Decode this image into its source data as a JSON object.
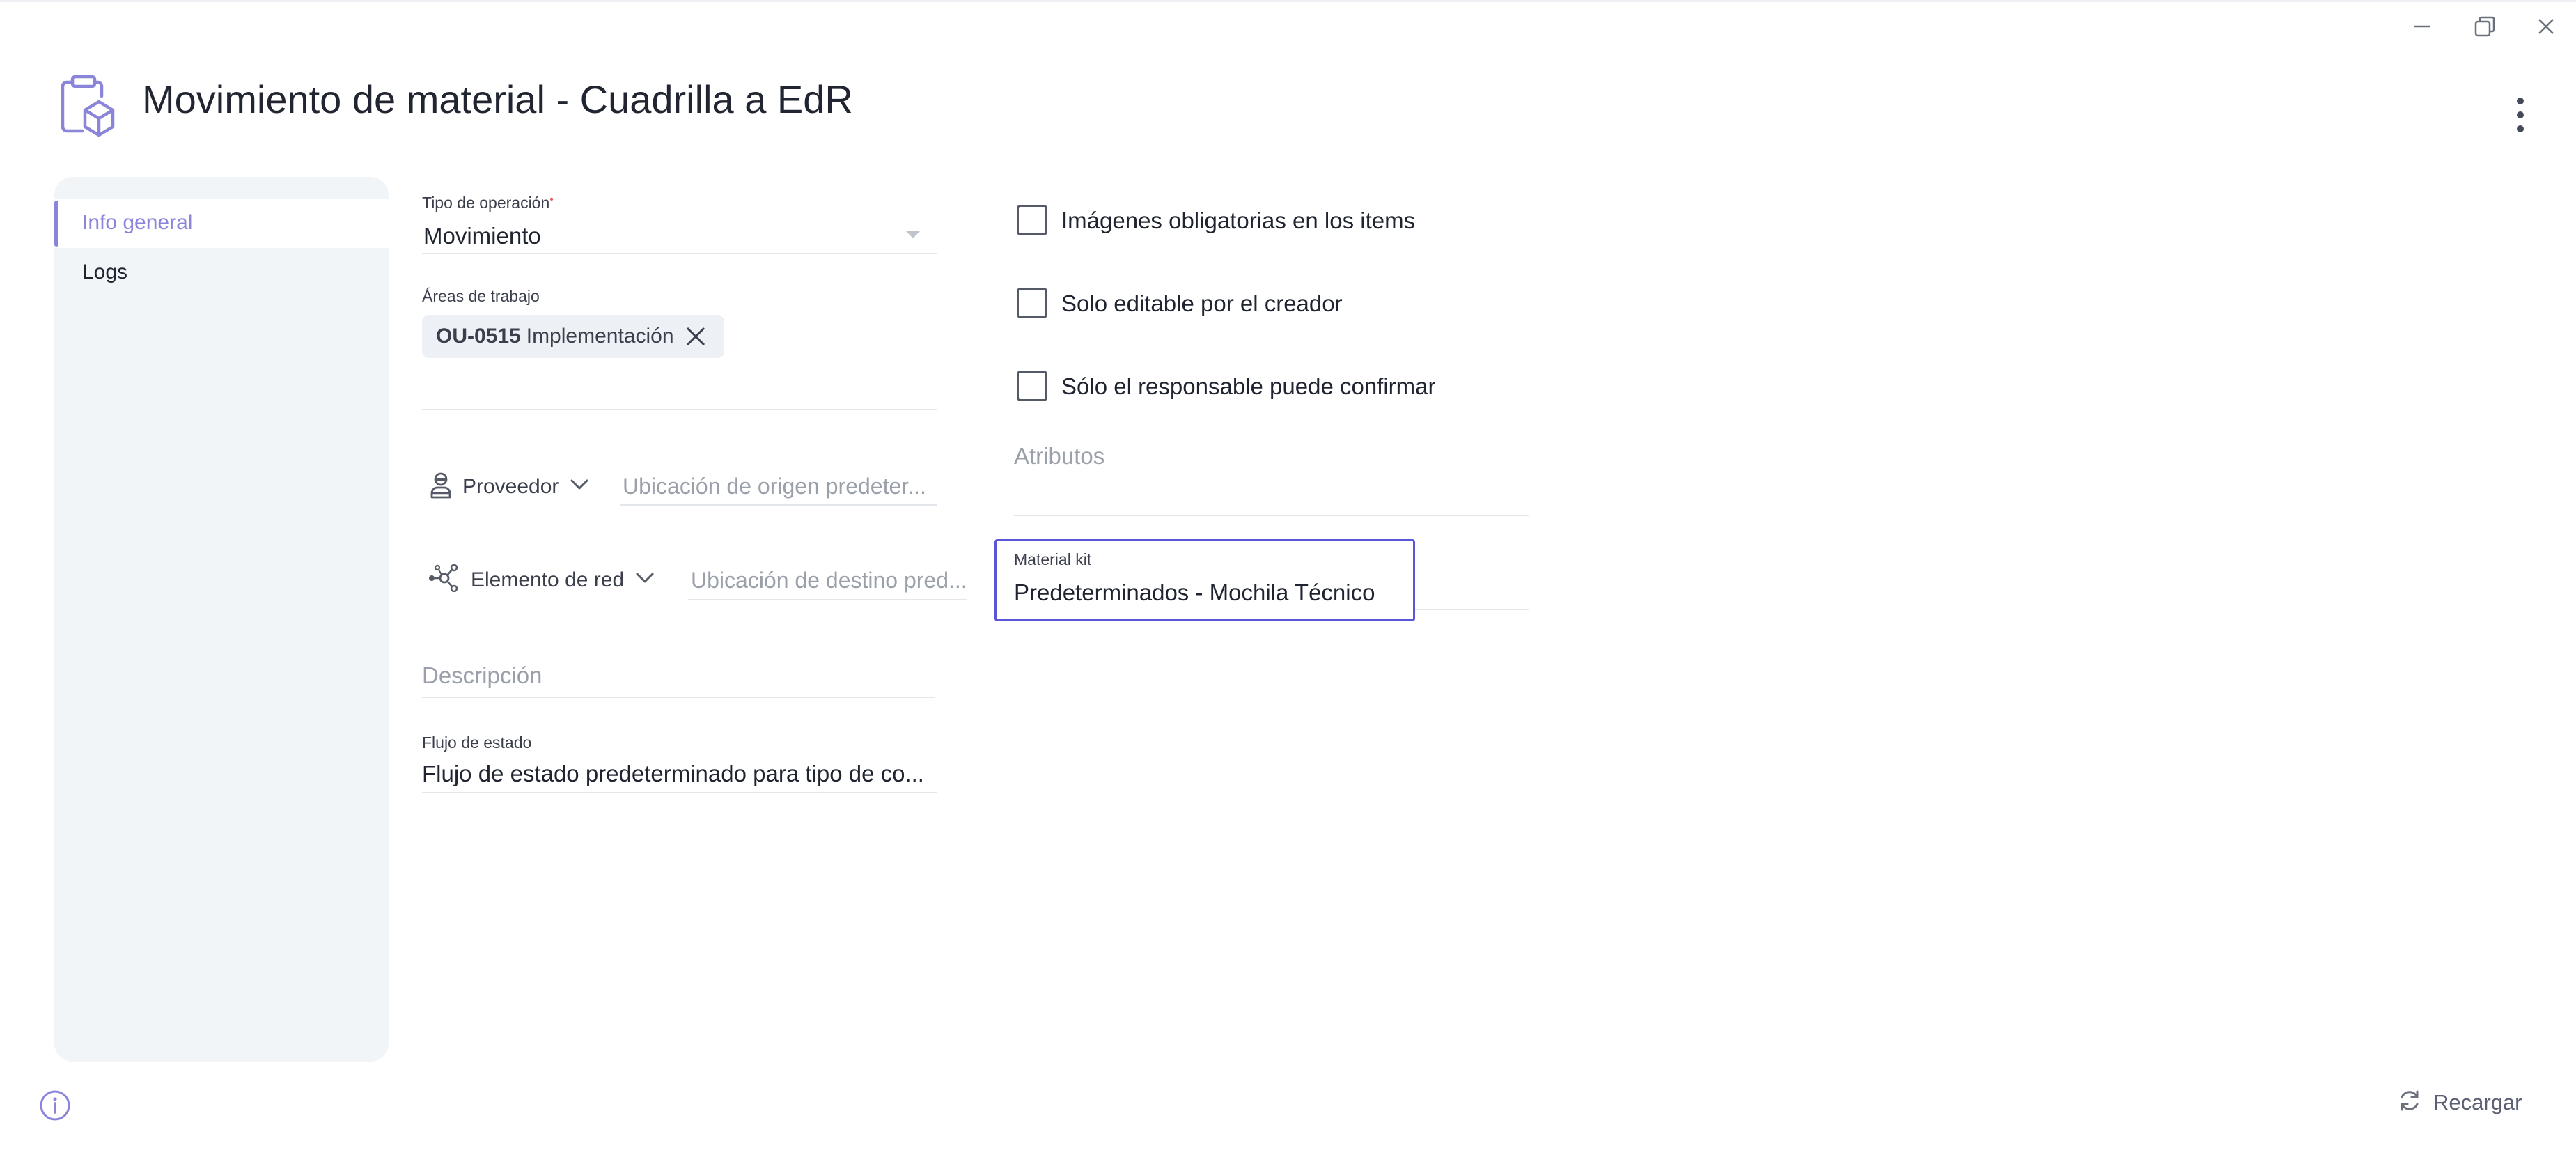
{
  "window": {
    "controls": [
      "minimize-icon",
      "restore-icon",
      "close-icon"
    ]
  },
  "header": {
    "title": "Movimiento de material - Cuadrilla a EdR",
    "icon": "package-clipboard-icon",
    "menu_icon": "kebab-menu-icon"
  },
  "sidebar": {
    "items": [
      {
        "label": "Info general",
        "active": true
      },
      {
        "label": "Logs",
        "active": false
      }
    ]
  },
  "form": {
    "tipo_operacion": {
      "label": "Tipo de operación",
      "required_mark": "•",
      "value": "Movimiento"
    },
    "areas_trabajo": {
      "label": "Áreas de trabajo",
      "chip_code": "OU-0515",
      "chip_name": "Implementación"
    },
    "origen": {
      "type_label": "Proveedor",
      "placeholder": "Ubicación de origen predeter..."
    },
    "destino": {
      "type_label": "Elemento de red",
      "placeholder": "Ubicación de destino pred..."
    },
    "descripcion": {
      "placeholder": "Descripción"
    },
    "flujo_estado": {
      "label": "Flujo de estado",
      "value": "Flujo de estado predeterminado para tipo de co..."
    },
    "checkboxes": [
      {
        "label": "Imágenes obligatorias en los items",
        "checked": false
      },
      {
        "label": "Solo editable por el creador",
        "checked": false
      },
      {
        "label": "Sólo el responsable puede confirmar",
        "checked": false
      }
    ],
    "atributos": {
      "placeholder": "Atributos"
    },
    "material_kit": {
      "label": "Material kit",
      "value": "Predeterminados - Mochila Técnico"
    }
  },
  "footer": {
    "info_icon": "info-icon",
    "reload_label": "Recargar"
  },
  "colors": {
    "accent": "#8a85d8",
    "focus": "#5b56d6",
    "sidebar_bg": "#f2f5f8"
  }
}
